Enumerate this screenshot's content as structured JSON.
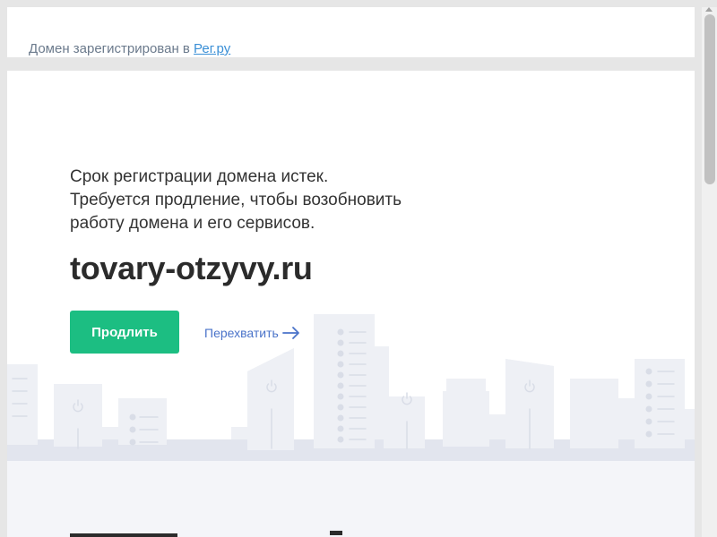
{
  "header": {
    "note_text": "Домен зарегистрирован в ",
    "registrar_link": "Рег.ру"
  },
  "main": {
    "message_lines": [
      "Срок регистрации домена истек.",
      "Требуется продление, чтобы возобновить",
      "работу домена и его сервисов."
    ],
    "domain_name": "tovary-otzyvy.ru",
    "renew_button": "Продлить",
    "intercept_link": "Перехватить"
  },
  "colors": {
    "accent_green": "#1cbe82",
    "link_blue": "#4a73c9",
    "registrar_link": "#3a8fd6"
  },
  "icons": [
    "arrow-right-icon",
    "power-icon",
    "scroll-up-icon"
  ]
}
